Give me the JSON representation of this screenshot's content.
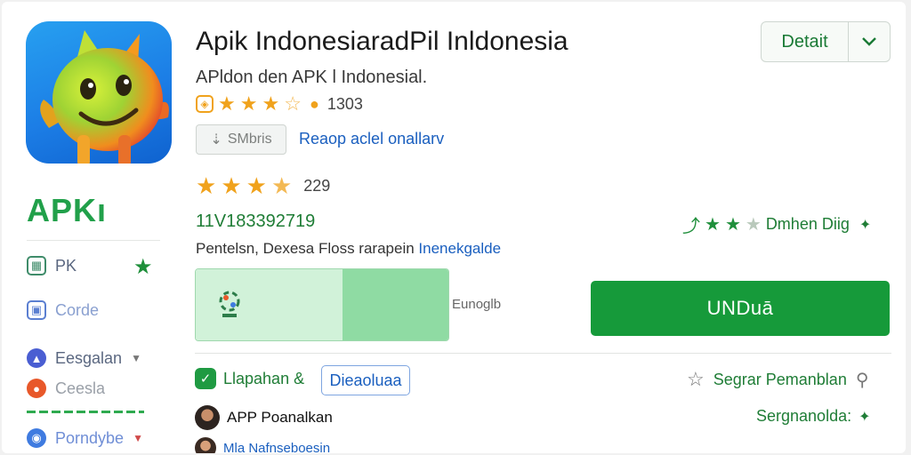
{
  "app": {
    "title": "Apik IndonesiaradPil Inldonesia",
    "subtitle": "APldon den APK l Indonesial.",
    "rating_count": "1303",
    "size_label": "SMbris",
    "size_link": "Reaop aclel onallarv",
    "rating_count_2": "229",
    "version_code": "11V183392719",
    "description_prefix": "Pentelsn, Dexesa Floss rarapein",
    "description_link": "Inenekgalde"
  },
  "header": {
    "detail_label": "Detait"
  },
  "sidebar": {
    "badge": "APKı",
    "items": [
      {
        "label": "PK",
        "icon": "grid-icon"
      },
      {
        "label": "Corde",
        "icon": "window-icon"
      },
      {
        "label": "Eesgalan",
        "icon": "bell-icon"
      },
      {
        "label": "Ceesla",
        "icon": "circle-icon"
      },
      {
        "label": "Porndybe",
        "icon": "globe-icon"
      }
    ]
  },
  "actions": {
    "right_rating_label": "Dmhen Diig",
    "progress_text": "Eunoglb",
    "download_label": "UNDuā",
    "check_label": "Llapahan &",
    "tag_label": "Dieaoluaa",
    "star_action_label": "Segrar Pemanblan",
    "green_action_label": "Sergnanolda:"
  },
  "reviews": [
    {
      "name": "APP Poanalkan"
    },
    {
      "name": "Mla Nafnseboesin"
    }
  ],
  "progress": {
    "fill_fraction": 0.58,
    "strong_start_fraction": 0.58,
    "strong_fraction": 0.42
  },
  "colors": {
    "accent_green": "#169a3a",
    "link_blue": "#1a5fbf",
    "star_gold": "#f0a21c"
  }
}
